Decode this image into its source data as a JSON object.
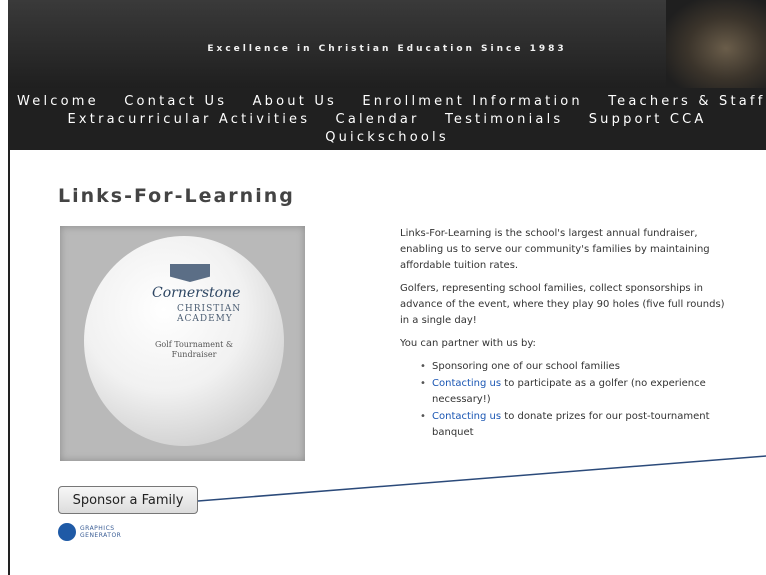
{
  "header": {
    "tagline": "Excellence in Christian Education Since 1983"
  },
  "nav": {
    "line1": [
      "Welcome",
      "Contact Us",
      "About Us",
      "Enrollment Information",
      "Teachers & Staff"
    ],
    "line2": [
      "Extracurricular Activities",
      "Calendar",
      "Testimonials",
      "Support CCA"
    ],
    "line3": [
      "Quickschools"
    ]
  },
  "main": {
    "title": "Links-For-Learning",
    "hero": {
      "logo_name": "Cornerstone",
      "logo_sub": "CHRISTIAN ACADEMY",
      "caption": "Golf Tournament & Fundraiser"
    },
    "paragraphs": [
      "Links-For-Learning is the school's largest annual fundraiser, enabling us to serve our community's families by maintaining affordable tuition rates.",
      "Golfers, representing school families, collect sponsorships in advance of the event, where they play 90 holes (five full rounds) in a single day!",
      "You can partner with us by:"
    ],
    "bullets": [
      {
        "link": "",
        "text": "Sponsoring one of our school families"
      },
      {
        "link": "Contacting us",
        "text": " to participate as a golfer (no experience necessary!)"
      },
      {
        "link": "Contacting us",
        "text": " to donate prizes for our post-tournament banquet"
      }
    ],
    "sponsor_button": "Sponsor a Family"
  },
  "footer": {
    "logo_text": "GRAPHICS GENERATOR"
  },
  "colors": {
    "link": "#1a56b3",
    "connector": "#2b4a7a"
  }
}
